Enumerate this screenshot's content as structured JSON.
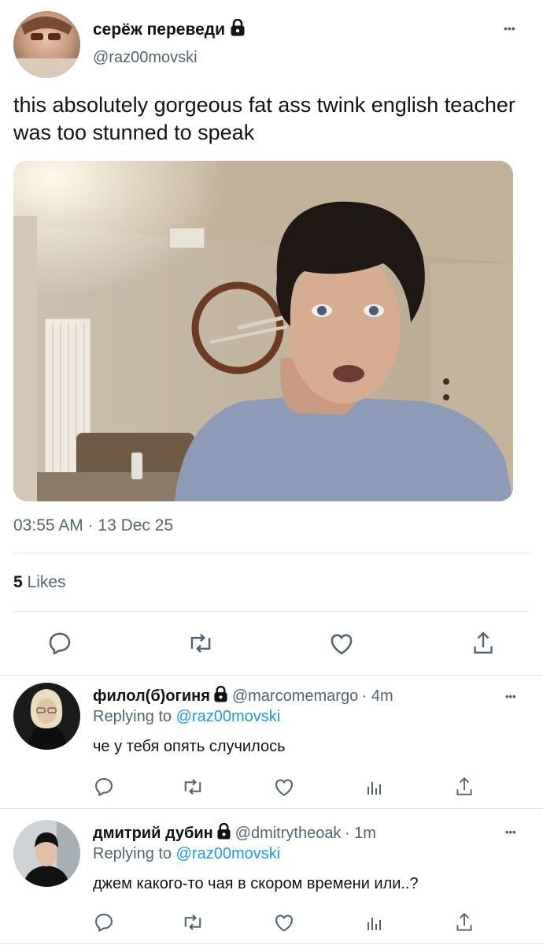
{
  "tweet": {
    "author_name": "серёж переведи",
    "author_handle": "@raz00movski",
    "text": "this absolutely gorgeous fat ass twink english teacher was too stunned to speak",
    "timestamp": "03:55 AM · 13 Dec 25",
    "likes_count": "5",
    "likes_label": "Likes",
    "more_label": "•••",
    "icons": [
      "reply-icon",
      "retweet-icon",
      "like-icon",
      "share-icon"
    ]
  },
  "replies": [
    {
      "author_name": "филол(б)огиня",
      "author_handle": "@marcomemargo",
      "time": "· 4m",
      "replying_prefix": "Replying to",
      "replying_handle": "@raz00movski",
      "text": "че у тебя опять случилось",
      "more_label": "•••"
    },
    {
      "author_name": "дмитрий дубин",
      "author_handle": "@dmitrytheoak",
      "time": "· 1m",
      "replying_prefix": "Replying to",
      "replying_handle": "@raz00movski",
      "text": "джем какого-то чая в скором времени или..?",
      "more_label": "•••"
    }
  ],
  "colors": {
    "link": "#1d9bf0",
    "secondary": "#536471",
    "divider": "#e6e6e6"
  }
}
